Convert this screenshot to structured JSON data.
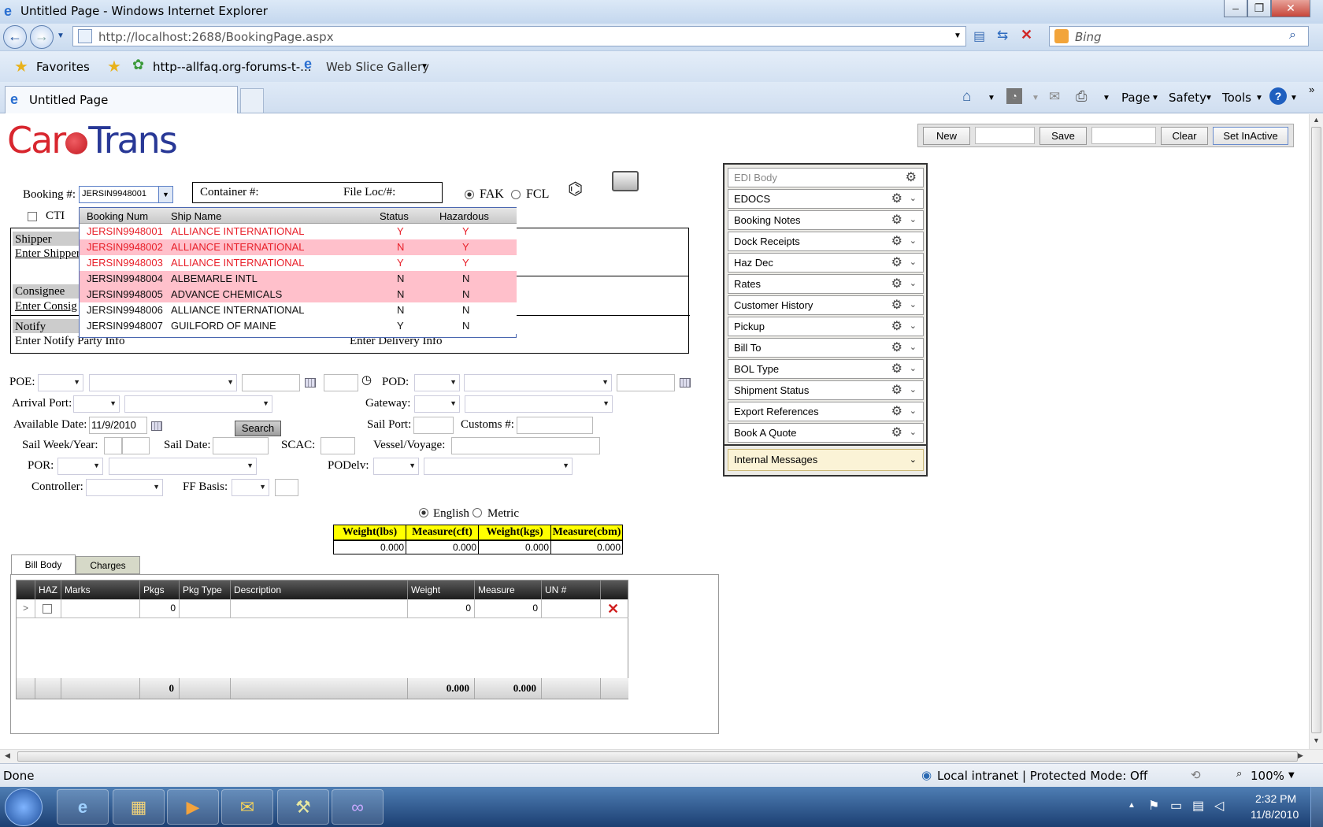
{
  "window": {
    "title": "Untitled Page - Windows Internet Explorer"
  },
  "browser": {
    "url": "http://localhost:2688/BookingPage.aspx",
    "search_placeholder": "Bing",
    "favorites_label": "Favorites",
    "fav_link_1": "http--allfaq.org-forums-t-...",
    "fav_link_2": "Web Slice Gallery",
    "tab_title": "Untitled Page",
    "cmd": {
      "page": "Page",
      "safety": "Safety",
      "tools": "Tools"
    }
  },
  "app": {
    "logo_part1": "Car",
    "logo_part2": "Trans",
    "toolbar": {
      "new": "New",
      "save": "Save",
      "clear": "Clear",
      "set_inactive": "Set InActive"
    },
    "booking_label": "Booking #:",
    "booking_value": "JERSIN9948001",
    "container_label": "Container #:",
    "file_loc_label": "File Loc/#:",
    "fak_label": "FAK",
    "fcl_label": "FCL",
    "cti_label": "CTI",
    "dropdown": {
      "headers": [
        "Booking Num",
        "Ship Name",
        "Status",
        "Hazardous"
      ],
      "rows": [
        {
          "num": "JERSIN9948001",
          "ship": "ALLIANCE INTERNATIONAL",
          "status": "Y",
          "haz": "Y"
        },
        {
          "num": "JERSIN9948002",
          "ship": "ALLIANCE INTERNATIONAL",
          "status": "N",
          "haz": "Y"
        },
        {
          "num": "JERSIN9948003",
          "ship": "ALLIANCE INTERNATIONAL",
          "status": "Y",
          "haz": "Y"
        },
        {
          "num": "JERSIN9948004",
          "ship": "ALBEMARLE INTL",
          "status": "N",
          "haz": "N"
        },
        {
          "num": "JERSIN9948005",
          "ship": "ADVANCE CHEMICALS",
          "status": "N",
          "haz": "N"
        },
        {
          "num": "JERSIN9948006",
          "ship": "ALLIANCE INTERNATIONAL",
          "status": "N",
          "haz": "N"
        },
        {
          "num": "JERSIN9948007",
          "ship": "GUILFORD OF MAINE",
          "status": "Y",
          "haz": "N"
        }
      ]
    },
    "parties": {
      "shipper": "Shipper",
      "enter_shipper": "Enter Shipper",
      "consignee": "Consignee",
      "enter_consignee": "Enter Consig",
      "notify": "Notify",
      "enter_notify": "Enter Notify Party Info",
      "enter_delivery": "Enter Delivery Info"
    },
    "form": {
      "poe": "POE:",
      "pod": "POD:",
      "arrival_port": "Arrival Port:",
      "gateway": "Gateway:",
      "available_date": "Available Date:",
      "available_date_value": "11/9/2010",
      "search": "Search",
      "sail_port": "Sail Port:",
      "customs": "Customs #:",
      "sail_week_year": "Sail Week/Year:",
      "sail_date": "Sail Date:",
      "scac": "SCAC:",
      "vessel_voyage": "Vessel/Voyage:",
      "por": "POR:",
      "podelv": "PODelv:",
      "controller": "Controller:",
      "ff_basis": "FF Basis:",
      "english": "English",
      "metric": "Metric"
    },
    "weights": {
      "headers": [
        "Weight(lbs)",
        "Measure(cft)",
        "Weight(kgs)",
        "Measure(cbm)"
      ],
      "values": [
        "0.000",
        "0.000",
        "0.000",
        "0.000"
      ]
    },
    "tabs": {
      "bill_body": "Bill Body",
      "charges": "Charges"
    },
    "grid": {
      "headers": [
        "HAZ",
        "Marks",
        "Pkgs",
        "Pkg Type",
        "Description",
        "Weight",
        "Measure",
        "UN #"
      ],
      "row": {
        "pkgs": "0",
        "weight": "0",
        "measure": "0"
      },
      "footer": {
        "pkgs": "0",
        "weight": "0.000",
        "measure": "0.000"
      }
    },
    "panel": {
      "items": [
        "EDI Body",
        "EDOCS",
        "Booking Notes",
        "Dock Receipts",
        "Haz Dec",
        "Rates",
        "Customer History",
        "Pickup",
        "Bill To",
        "BOL Type",
        "Shipment Status",
        "Export References",
        "Book A Quote"
      ],
      "internal_messages": "Internal Messages"
    }
  },
  "status": {
    "left": "Done",
    "zone": "Local intranet | Protected Mode: Off",
    "zoom": "100%"
  },
  "clock": {
    "time": "2:32 PM",
    "date": "11/8/2010"
  }
}
